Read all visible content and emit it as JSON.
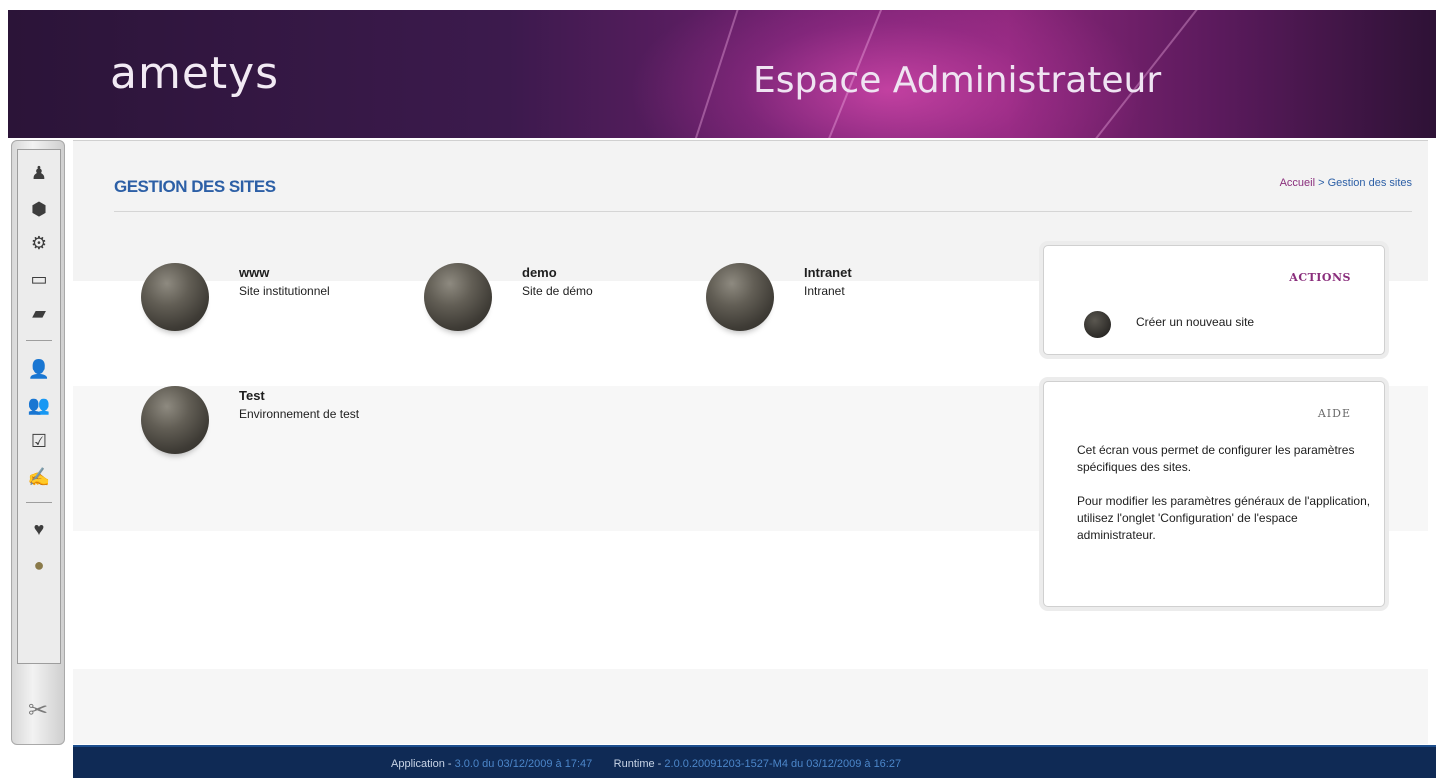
{
  "header": {
    "logo": "ametys",
    "space_title": "Espace Administrateur"
  },
  "sidebar": {
    "items": [
      {
        "icon": "bell-icon",
        "glyph": "♟"
      },
      {
        "icon": "plugin-icon",
        "glyph": "⬢"
      },
      {
        "icon": "gear-icon",
        "glyph": "⚙"
      },
      {
        "icon": "workspace-icon",
        "glyph": "▭"
      },
      {
        "icon": "card-icon",
        "glyph": "▰"
      },
      {
        "icon": "user-icon",
        "glyph": "👤"
      },
      {
        "icon": "users-icon",
        "glyph": "👥"
      },
      {
        "icon": "checkbox-icon",
        "glyph": "☑"
      },
      {
        "icon": "user-edit-icon",
        "glyph": "✍"
      },
      {
        "icon": "heart-icon",
        "glyph": "♥"
      },
      {
        "icon": "globe-icon",
        "glyph": "●"
      }
    ],
    "bottom_icon": "tools-icon"
  },
  "page": {
    "title": "GESTION DES SITES",
    "breadcrumb_home": "Accueil",
    "breadcrumb_sep": ">",
    "breadcrumb_current": "Gestion des sites"
  },
  "sites": [
    {
      "name": "www",
      "description": "Site institutionnel"
    },
    {
      "name": "demo",
      "description": "Site de démo"
    },
    {
      "name": "Intranet",
      "description": "Intranet"
    },
    {
      "name": "Test",
      "description": "Environnement de test"
    }
  ],
  "actions": {
    "title": "ACTIONS",
    "create_site": "Créer un nouveau site"
  },
  "help": {
    "title": "AIDE",
    "paragraph1": "Cet écran vous permet de configurer les paramètres spécifiques des sites.",
    "paragraph2": "Pour modifier les paramètres généraux de l'application, utilisez l'onglet 'Configuration' de l'espace administrateur."
  },
  "footer": {
    "app_label": "Application -",
    "app_version": "3.0.0 du 03/12/2009 à 17:47",
    "runtime_label": "Runtime -",
    "runtime_version": "2.0.0.20091203-1527-M4 du 03/12/2009 à 16:27"
  }
}
